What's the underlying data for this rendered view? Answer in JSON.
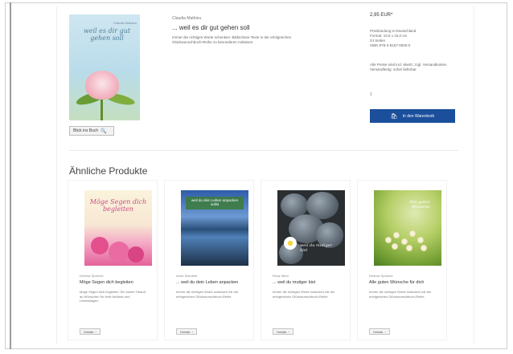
{
  "product": {
    "author": "Claudia Mathieu",
    "title": "... weil es dir gut gehen soll",
    "description": "Immer die richtigen Worte schenken: Bildschöne Texte in der erfolgreichen Glückwunschbuch-Reihe zu besonderen Anlässen.",
    "cover_title": "weil es dir gut gehen soll",
    "look_inside_label": "Blick ins Buch",
    "look_inside_icon": "magnifier-icon"
  },
  "purchase": {
    "price": "2,95 EUR*",
    "details": [
      "Preisbindung in Deutschland",
      "Format: 10,5 x 15,0 cm",
      "24 Seiten",
      "ISBN 978-3-8157-0000-0"
    ],
    "shipping": [
      "Alle Preise sind incl. MwSt. zzgl. Versandkosten",
      "Versandfertig: sofort lieferbar"
    ],
    "quantity": "1",
    "cart_label": "In den Warenkorb",
    "cart_icon": "shopping-bag-icon"
  },
  "related": {
    "heading": "Ähnliche Produkte",
    "items": [
      {
        "author": "Diverse Sprüche",
        "title": "Möge Segen dich begleiten",
        "description": "Möge Segen dich begleiten: Ein bunter Strauß an Wünschen für viele Anlässe und Lebenslagen.",
        "cover_text": "Möge Segen dich begleiten",
        "button_label": "Details"
      },
      {
        "author": "Anne Schubert",
        "title": "... weil du dein Leben anpacken",
        "description": "Immer die richtigen Worte schenken mit der erfolgreichen Glückwunschbuch-Reihe.",
        "cover_text": "weil du dein Leben anpacken sollst",
        "button_label": "Details"
      },
      {
        "author": "Rosa Stern",
        "title": "... weil du mutiger bist",
        "description": "Immer die richtigen Worte schenken mit der erfolgreichen Glückwunschbuch-Reihe.",
        "cover_text": "weil du mutiger bist",
        "button_label": "Details"
      },
      {
        "author": "Diverse Sprüche",
        "title": "Alle guten Wünsche für dich",
        "description": "Immer die richtigen Worte schenken mit der erfolgreichen Glückwunschbuch-Reihe.",
        "cover_text": "Alle guten Wünsche",
        "button_label": "Details"
      }
    ]
  },
  "colors": {
    "accent": "#1b4f9c",
    "border": "#cfcfcf"
  }
}
